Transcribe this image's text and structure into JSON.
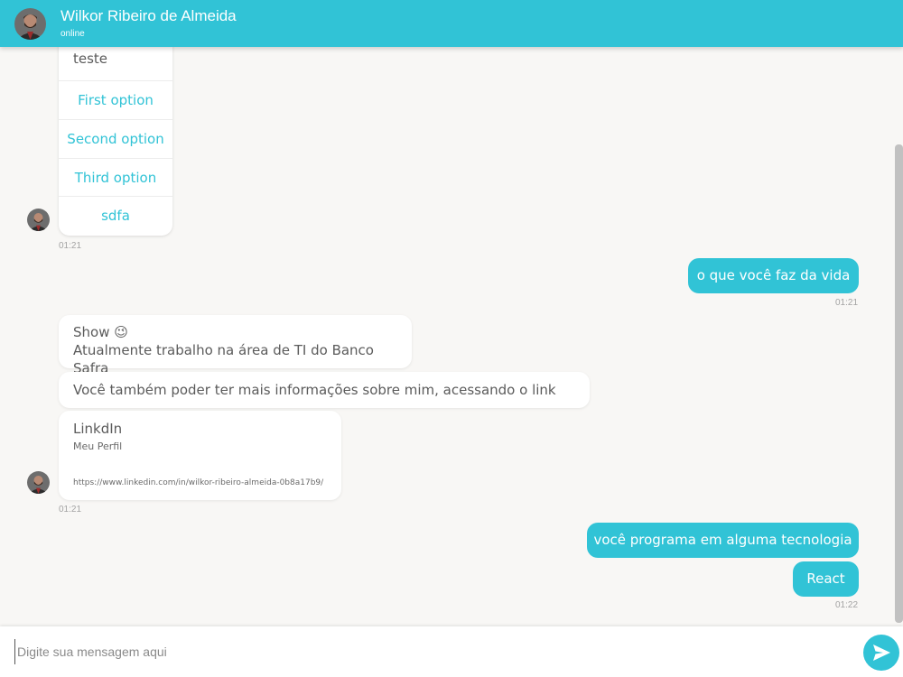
{
  "header": {
    "name": "Wilkor Ribeiro de Almeida",
    "status": "online"
  },
  "conversation": {
    "options_card": {
      "title": "teste",
      "options": [
        "First option",
        "Second option",
        "Third option",
        "sdfa"
      ],
      "time": "01:21"
    },
    "sent_1": {
      "text": "o que você faz da vida",
      "time": "01:21"
    },
    "received_1": {
      "line1": "Show 😉",
      "line2": "Atualmente trabalho na área de TI do Banco Safra"
    },
    "received_2": {
      "text": "Você também poder ter mais informações sobre mim, acessando o link abaixo."
    },
    "link_card": {
      "title": "LinkdIn",
      "subtitle": "Meu Perfil",
      "url": "https://www.linkedin.com/in/wilkor-ribeiro-almeida-0b8a17b9/",
      "time": "01:21"
    },
    "sent_2": {
      "text": "você programa em alguma tecnologia"
    },
    "sent_3": {
      "text": "React",
      "time": "01:22"
    }
  },
  "composer": {
    "placeholder": "Digite sua mensagem aqui"
  },
  "colors": {
    "accent": "#31c3d6",
    "background": "#f8f7f5"
  },
  "icons": {
    "header_avatar": "avatar",
    "send": "send-icon"
  }
}
